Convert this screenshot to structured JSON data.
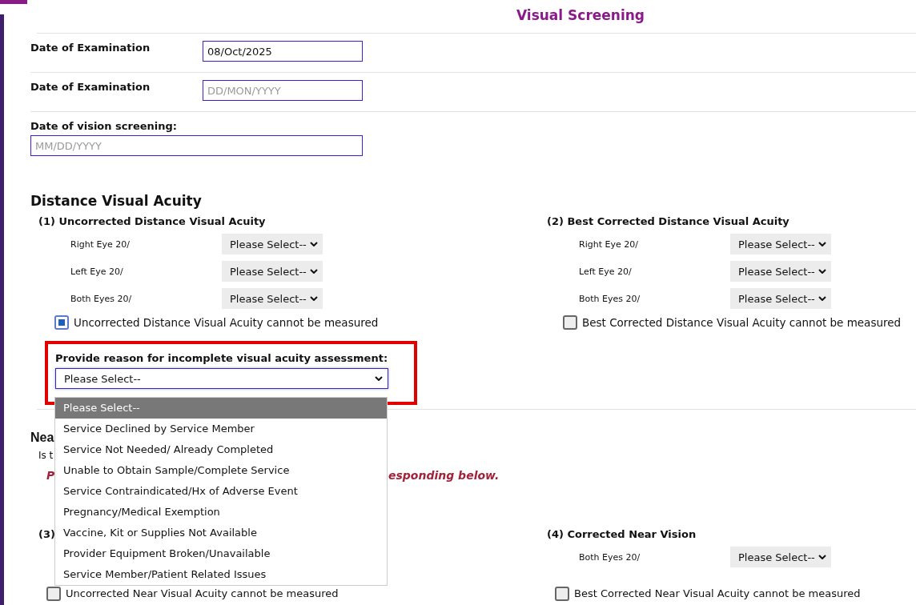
{
  "page": {
    "title": "Visual Screening"
  },
  "date_fields": [
    {
      "label": "Date of Examination",
      "value": "08/Oct/2025",
      "kind": "inline"
    },
    {
      "label": "Date of Examination",
      "placeholder": "DD/MON/YYYY",
      "kind": "inline"
    },
    {
      "label": "Date of vision screening:",
      "placeholder": "MM/DD/YYYY",
      "kind": "stacked"
    }
  ],
  "distance_visual_acuity": {
    "heading": "Distance Visual Acuity",
    "groups": [
      {
        "title": "(1) Uncorrected Distance Visual Acuity",
        "rows": [
          {
            "label": "Right Eye 20/",
            "value": "Please Select--"
          },
          {
            "label": "Left Eye 20/",
            "value": "Please Select--"
          },
          {
            "label": "Both Eyes 20/",
            "value": "Please Select--"
          }
        ],
        "cannot_measure": {
          "label": "Uncorrected Distance Visual Acuity cannot be measured",
          "checked": true
        }
      },
      {
        "title": "(2) Best Corrected Distance Visual Acuity",
        "rows": [
          {
            "label": "Right Eye 20/",
            "value": "Please Select--"
          },
          {
            "label": "Left Eye 20/",
            "value": "Please Select--"
          },
          {
            "label": "Both Eyes 20/",
            "value": "Please Select--"
          }
        ],
        "cannot_measure": {
          "label": "Best Corrected Distance Visual Acuity cannot be measured",
          "checked": false
        }
      }
    ],
    "reason": {
      "label": "Provide reason for incomplete visual acuity assessment:",
      "value": "Please Select--",
      "expanded": true,
      "options": [
        {
          "label": "Please Select--",
          "selected": true
        },
        {
          "label": "Service Declined by Service Member",
          "selected": false
        },
        {
          "label": "Service Not Needed/ Already Completed",
          "selected": false
        },
        {
          "label": "Unable to Obtain Sample/Complete Service",
          "selected": false
        },
        {
          "label": "Service Contraindicated/Hx of Adverse Event",
          "selected": false
        },
        {
          "label": "Pregnancy/Medical Exemption",
          "selected": false
        },
        {
          "label": "Vaccine, Kit or Supplies Not Available",
          "selected": false
        },
        {
          "label": "Provider Equipment Broken/Unavailable",
          "selected": false
        },
        {
          "label": "Service Member/Patient Related Issues",
          "selected": false
        }
      ]
    }
  },
  "near_visual_acuity": {
    "heading": "Nea",
    "question": "Is t",
    "instruction_start": "P",
    "instruction_end": "esponding below.",
    "groups": [
      {
        "title": "(3)",
        "cannot_measure": {
          "label": "Uncorrected Near Visual Acuity cannot be measured",
          "checked": false
        }
      },
      {
        "title": "(4) Corrected Near Vision",
        "rows": [
          {
            "label": "Both Eyes 20/",
            "value": "Please Select--"
          }
        ],
        "cannot_measure": {
          "label": "Best Corrected Near Visual Acuity cannot be measured",
          "checked": false
        }
      }
    ]
  }
}
